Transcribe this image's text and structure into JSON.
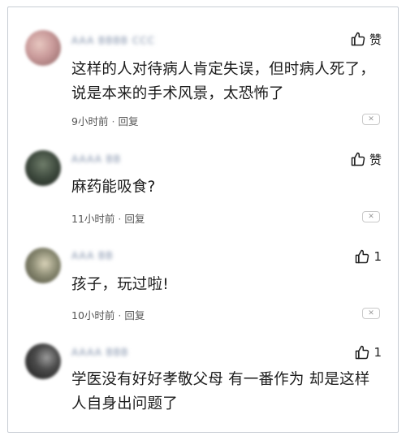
{
  "comments": [
    {
      "username": "AAA BBBB CCC",
      "text": "这样的人对待病人肯定失误，但时病人死了，说是本来的手术风景，太恐怖了",
      "time": "9小时前",
      "reply": "回复",
      "like": "赞",
      "dismiss": "✕",
      "avatar_color": "#c99a9a"
    },
    {
      "username": "AAAA BB",
      "text": "麻药能吸食?",
      "time": "11小时前",
      "reply": "回复",
      "like": "赞",
      "dismiss": "✕",
      "avatar_color": "#3e4a3e"
    },
    {
      "username": "AAA BB",
      "text": "孩子，玩过啦!",
      "time": "10小时前",
      "reply": "回复",
      "like": "1",
      "dismiss": "✕",
      "avatar_color": "#8a8a72"
    },
    {
      "username": "AAAA BBB",
      "text": "学医没有好好孝敬父母 有一番作为 却是这样 人自身出问题了",
      "time": "",
      "reply": "",
      "like": "1",
      "dismiss": "",
      "avatar_color": "#2a2a2a"
    }
  ],
  "icons": {
    "like": "thumbs-up-icon",
    "dismiss": "close-icon"
  }
}
